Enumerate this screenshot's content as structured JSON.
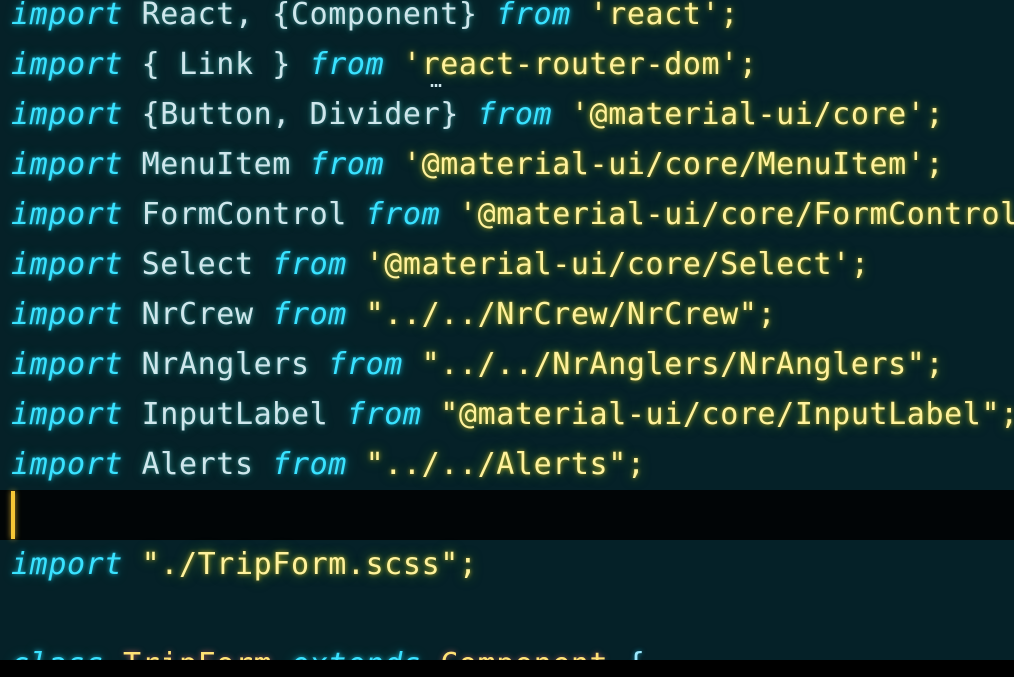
{
  "editor": {
    "lines": [
      {
        "kw": "import",
        "spec": " React, {Component} ",
        "from": "from",
        "src": "'react'",
        "end": ";"
      },
      {
        "kw": "import",
        "spec": " { Link } ",
        "from": "from",
        "src": "'react-router-dom'",
        "end": ";"
      },
      {
        "kw": "import",
        "spec": " {Button, Divider} ",
        "from": "from",
        "src": "'@material-ui/core'",
        "end": ";"
      },
      {
        "kw": "import",
        "spec": " MenuItem ",
        "from": "from",
        "src": "'@material-ui/core/MenuItem'",
        "end": ";"
      },
      {
        "kw": "import",
        "spec": " FormControl ",
        "from": "from",
        "src": "'@material-ui/core/FormControl'",
        "end": ";"
      },
      {
        "kw": "import",
        "spec": " Select ",
        "from": "from",
        "src": "'@material-ui/core/Select'",
        "end": ";"
      },
      {
        "kw": "import",
        "spec": " NrCrew ",
        "from": "from",
        "src": "\"../../NrCrew/NrCrew\"",
        "end": ";"
      },
      {
        "kw": "import",
        "spec": " NrAnglers ",
        "from": "from",
        "src": "\"../../NrAnglers/NrAnglers\"",
        "end": ";"
      },
      {
        "kw": "import",
        "spec": " InputLabel ",
        "from": "from",
        "src": "\"@material-ui/core/InputLabel\"",
        "end": ";"
      },
      {
        "kw": "import",
        "spec": " Alerts ",
        "from": "from",
        "src": "\"../../Alerts\"",
        "end": ";"
      }
    ],
    "style_import": {
      "kw": "import",
      "src": "\"./TripForm.scss\"",
      "end": ";"
    },
    "class_line": {
      "kw": "class",
      "name": "TripForm",
      "extends": "extends",
      "parent": "Component",
      "brace": "{"
    },
    "hint_ellipsis": "…"
  },
  "colors": {
    "background": "#062127",
    "current_line": "#010506",
    "keyword": "#3fe0ff",
    "string": "#fff2a0",
    "identifier": "#cfe7ec",
    "cursor": "#f5c63d"
  }
}
